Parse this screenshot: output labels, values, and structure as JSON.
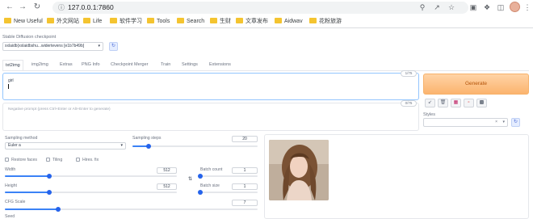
{
  "browser": {
    "url": "127.0.0.1:7860",
    "bookmarks": [
      "New Useful",
      "外文网站",
      "Life",
      "软件学习",
      "Tools",
      "Search",
      "生财",
      "文章发布",
      "Aidwav",
      "花粉旅游"
    ]
  },
  "checkpoint": {
    "label": "Stable Diffusion checkpoint",
    "value": "xxlaidb(xxlaidbshu...widertevens [e1b7b49b]"
  },
  "tabs": [
    "txt2img",
    "img2img",
    "Extras",
    "PNG Info",
    "Checkpoint Merger",
    "Train",
    "Settings",
    "Extensions"
  ],
  "prompt": {
    "text": "girl",
    "counter": "1/75",
    "negative_placeholder": "Negative prompt (press Ctrl+Enter or Alt+Enter to generate)",
    "negative_counter": "0/75"
  },
  "generate_label": "Generate",
  "styles_label": "Styles",
  "sampling": {
    "method_label": "Sampling method",
    "method_value": "Euler a",
    "steps_label": "Sampling steps",
    "steps_value": "20",
    "steps_frac": 0.13
  },
  "options": [
    "Restore faces",
    "Tiling",
    "Hires. fix"
  ],
  "width": {
    "label": "Width",
    "value": "512",
    "frac": 0.26
  },
  "height": {
    "label": "Height",
    "value": "512",
    "frac": 0.26
  },
  "batch_count": {
    "label": "Batch count",
    "value": "1",
    "frac": 0.0
  },
  "batch_size": {
    "label": "Batch size",
    "value": "1",
    "frac": 0.0
  },
  "cfg": {
    "label": "CFG Scale",
    "value": "7",
    "frac": 0.21
  },
  "seed_label": "Seed",
  "colors": {
    "accent": "#3b82f6",
    "generate": "#fbb46e"
  }
}
